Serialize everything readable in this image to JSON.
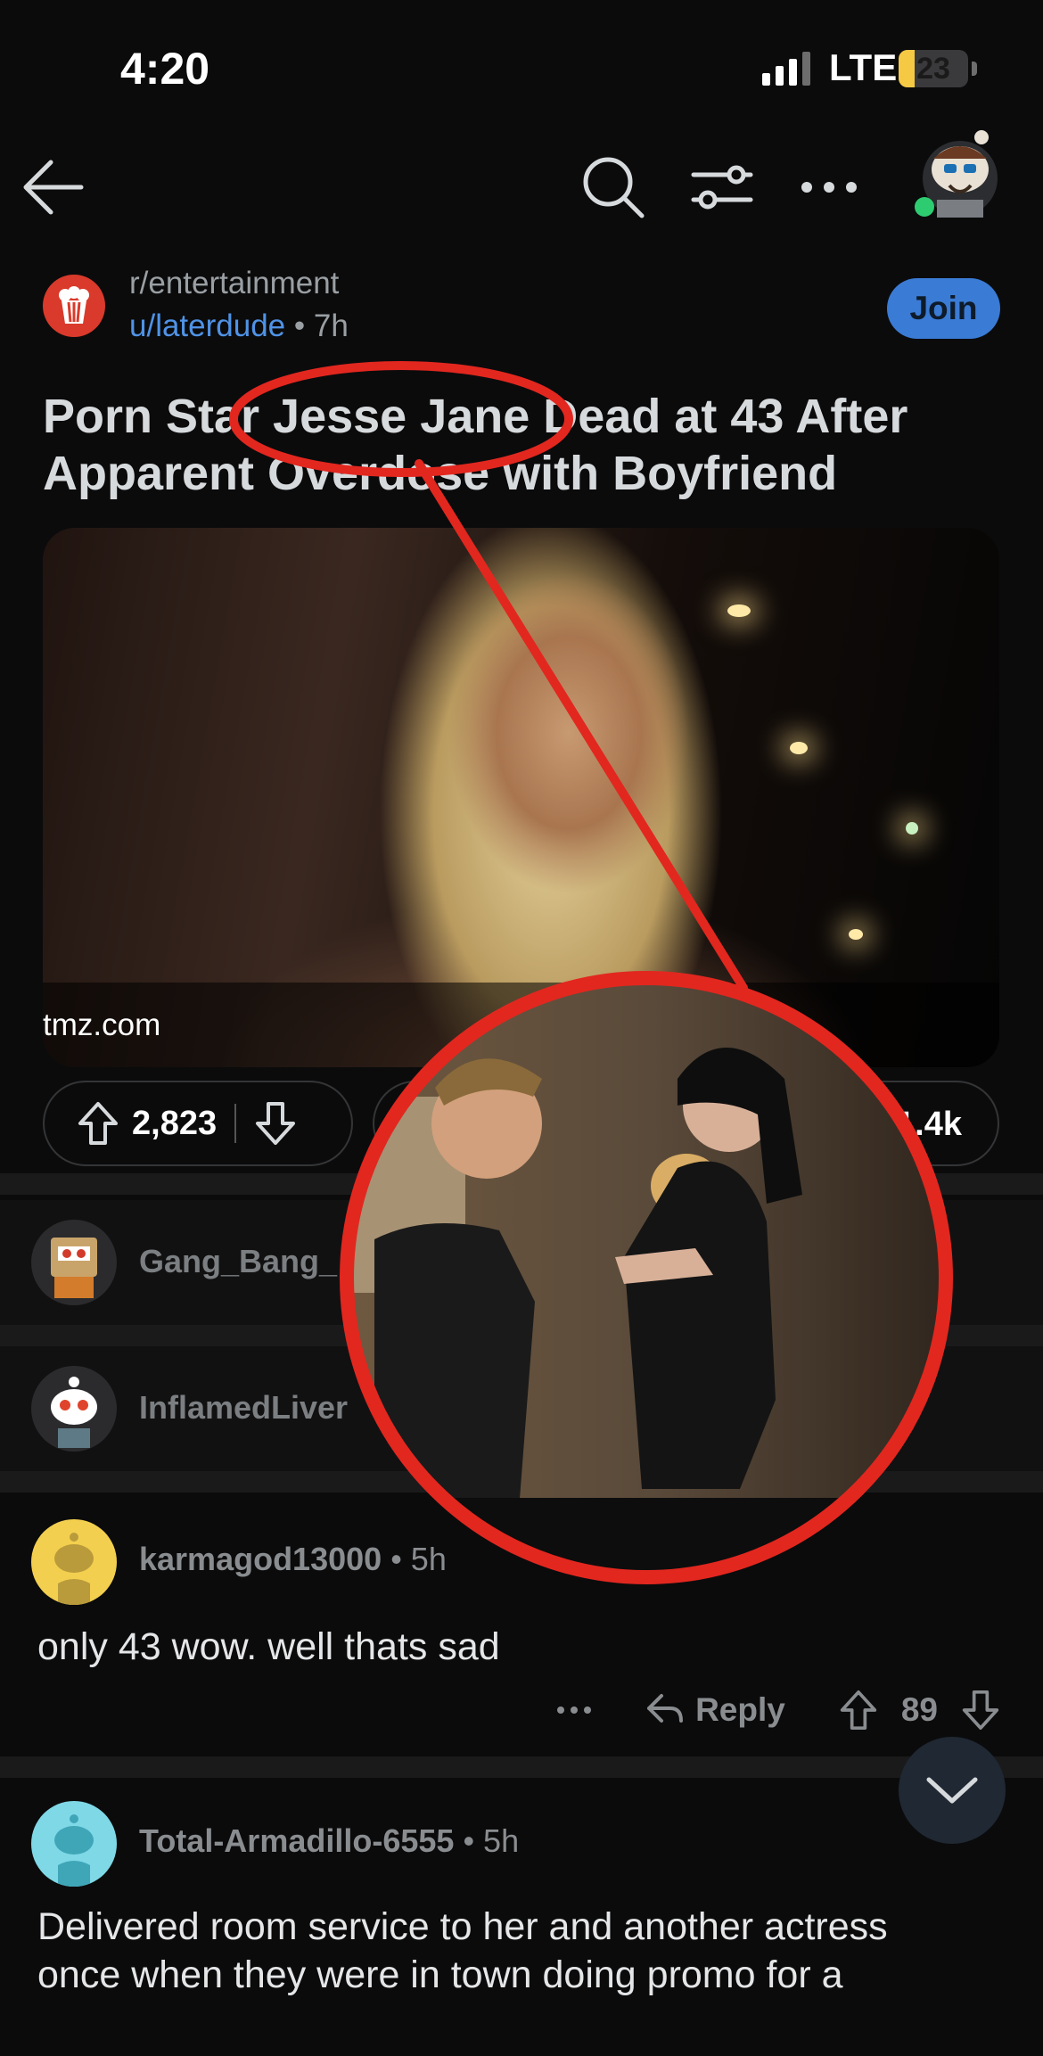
{
  "status_bar": {
    "time": "4:20",
    "network": "LTE",
    "battery": "23",
    "battery_level": 0.23
  },
  "nav": {
    "icons": [
      "back-arrow-icon",
      "search-icon",
      "filter-sliders-icon",
      "more-icon",
      "user-avatar"
    ]
  },
  "post": {
    "subreddit": "r/entertainment",
    "author": "u/laterdude",
    "age": "7h",
    "join_label": "Join",
    "title_line1": "Porn Star Jesse Jane Dead at 43 After",
    "title_line2": "Apparent Overdose with Boyfriend",
    "domain": "tmz.com",
    "upvotes": "2,823",
    "share_count": "1.4k"
  },
  "comments": [
    {
      "username": "Gang_Bang_",
      "collapsed": true
    },
    {
      "username": "InflamedLiver",
      "collapsed": true
    },
    {
      "username": "karmagod13000",
      "age": "5h",
      "body": "only 43 wow.  well thats sad",
      "reply_label": "Reply",
      "score": "89"
    },
    {
      "username": "Total-Armadillo-6555",
      "age": "5h",
      "body_line1": "Delivered room service to her and another actress",
      "body_line2": "once when they were in town doing promo for a"
    }
  ],
  "colors": {
    "accent": "#3a7bd5",
    "author": "#4f93e6",
    "annotation_red": "#e2271f"
  }
}
